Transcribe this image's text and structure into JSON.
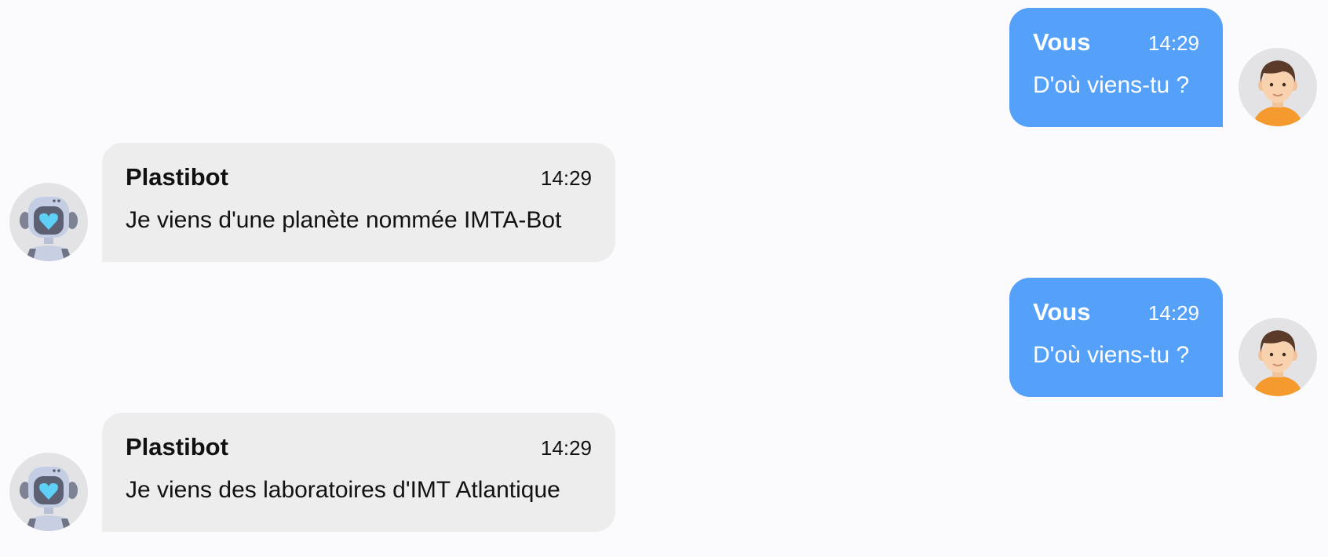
{
  "colors": {
    "background": "#fbfbfd",
    "user_bubble": "#55a1fa",
    "bot_bubble": "#ededed",
    "avatar_bg": "#e3e3e6"
  },
  "messages": [
    {
      "sender": "user",
      "name": "Vous",
      "time": "14:29",
      "text": "D'où viens-tu ?",
      "avatar_icon": "user-avatar-icon"
    },
    {
      "sender": "bot",
      "name": "Plastibot",
      "time": "14:29",
      "text": "Je viens d'une planète nommée IMTA-Bot",
      "avatar_icon": "robot-avatar-icon"
    },
    {
      "sender": "user",
      "name": "Vous",
      "time": "14:29",
      "text": "D'où viens-tu ?",
      "avatar_icon": "user-avatar-icon"
    },
    {
      "sender": "bot",
      "name": "Plastibot",
      "time": "14:29",
      "text": "Je viens des laboratoires d'IMT Atlantique",
      "avatar_icon": "robot-avatar-icon"
    }
  ]
}
